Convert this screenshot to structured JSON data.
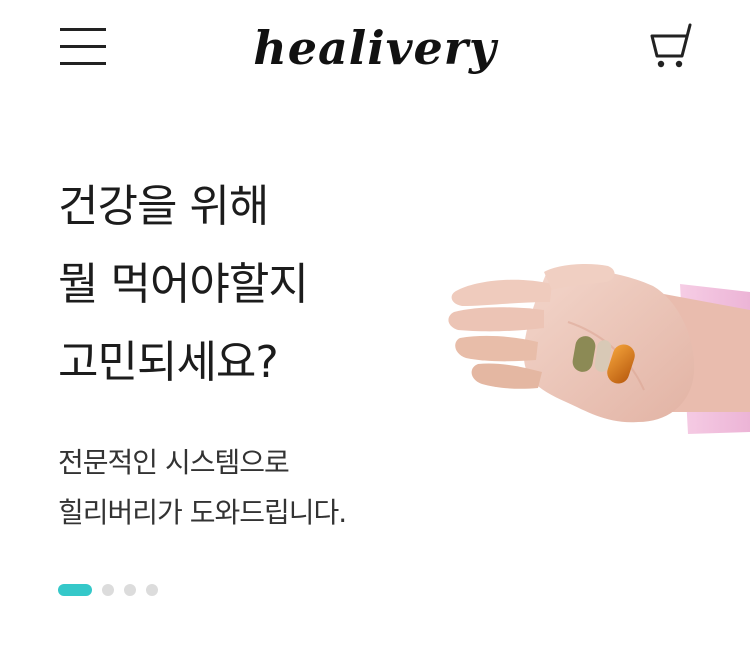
{
  "header": {
    "logo_text": "healivery",
    "menu_icon": "hamburger-menu-icon",
    "cart_icon": "shopping-cart-icon"
  },
  "hero": {
    "title_lines": [
      "건강을 위해",
      "뭘 먹어야할지",
      "고민되세요?"
    ],
    "subtitle_lines": [
      "전문적인 시스템으로",
      "힐리버리가 도와드립니다."
    ],
    "image": "hand-holding-supplement-pills"
  },
  "carousel": {
    "slide_count": 4,
    "active_index": 0
  },
  "colors": {
    "accent": "#35c8c9",
    "dot_inactive": "#dcdcdc",
    "text": "#1c1c1c"
  }
}
